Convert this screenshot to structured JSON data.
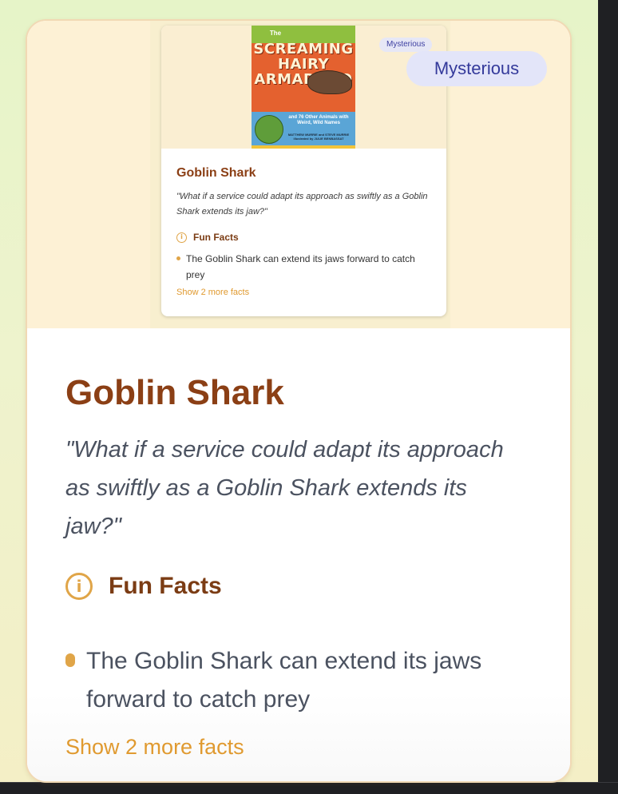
{
  "book_cover": {
    "the": "The",
    "title": "SCREAMING HAIRY ARMADILLO",
    "subtitle": "and 76 Other Animals with Weird, Wild Names",
    "authors": "MATTHEW MURRIE and STEVE MURRIE illustrated by JULIE BENBASSAT"
  },
  "mini_card": {
    "badge": "Mysterious",
    "title": "Goblin Shark",
    "quote": "\"What if a service could adapt its approach as swiftly as a Goblin Shark extends its jaw?\"",
    "facts_heading": "Fun Facts",
    "fact": "The Goblin Shark can extend its jaws forward to catch prey",
    "show_more": "Show 2 more facts"
  },
  "card": {
    "badge": "Mysterious",
    "title": "Goblin Shark",
    "quote": "\"What if a service could adapt its approach as swiftly as a Goblin Shark extends its jaw?\"",
    "facts_heading": "Fun Facts",
    "facts": [
      "The Goblin Shark can extend its jaws forward to catch prey"
    ],
    "show_more": "Show 2 more facts"
  },
  "icons": {
    "facts": "info-icon"
  },
  "colors": {
    "title": "#8b3f15",
    "accent": "#e0a548",
    "badge_bg": "#e3e5f9",
    "badge_text": "#343a9b"
  }
}
